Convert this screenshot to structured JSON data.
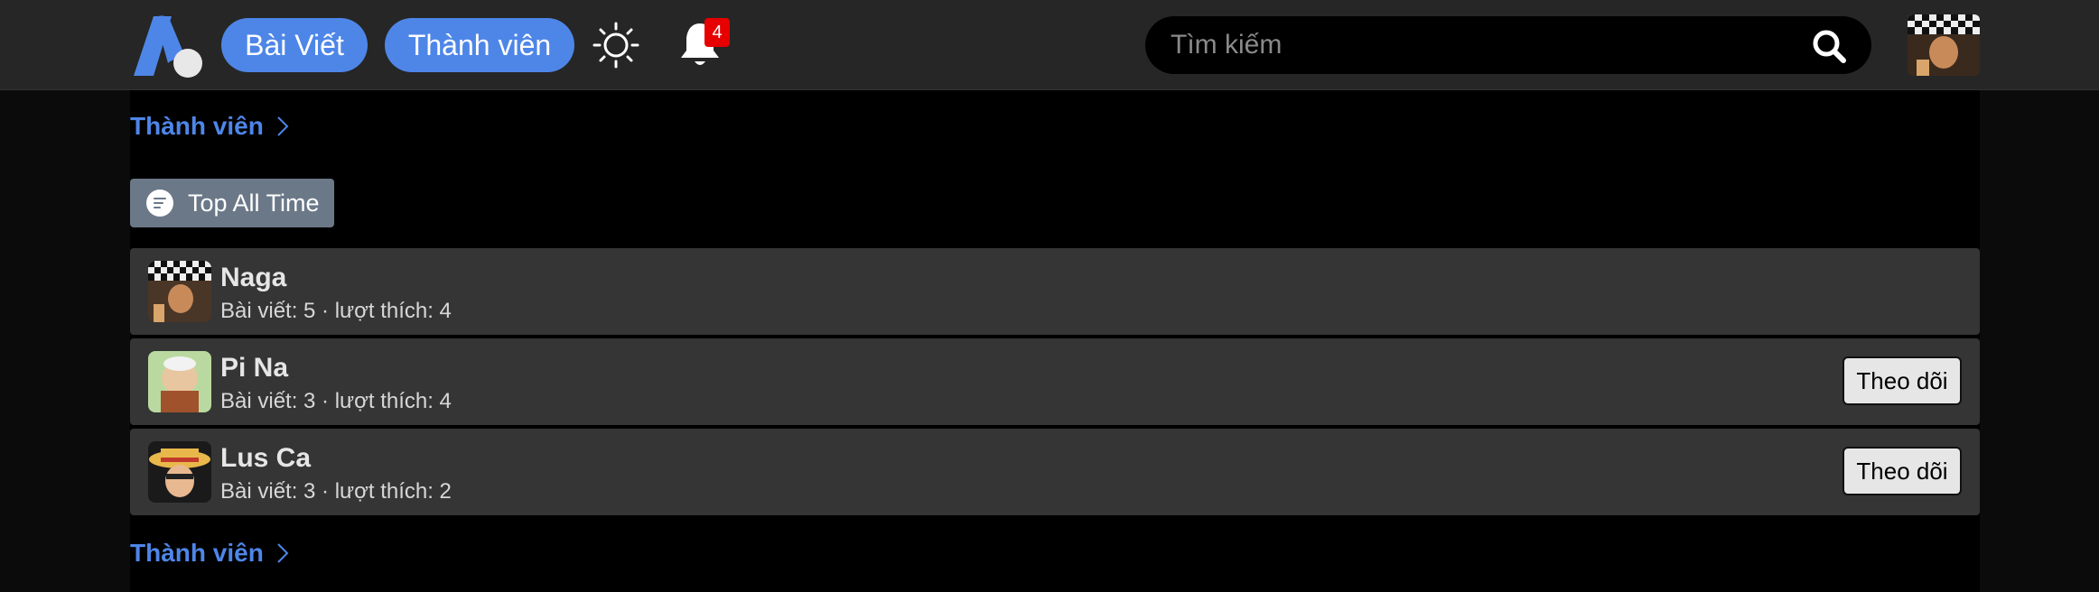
{
  "header": {
    "nav": [
      {
        "label": "Bài Viết"
      },
      {
        "label": "Thành viên"
      }
    ],
    "notification_count": "4",
    "search": {
      "placeholder": "Tìm kiếm"
    },
    "brand_color": "#4e86e8"
  },
  "breadcrumb": {
    "label": "Thành viên"
  },
  "filter": {
    "label": "Top All Time"
  },
  "members": [
    {
      "name": "Naga",
      "stats": "Bài viết: 5 · lượt thích: 4",
      "avatar": "checker-hat-avatar"
    },
    {
      "name": "Pi Na",
      "stats": "Bài viết: 3 · lượt thích: 4",
      "avatar": "green-bg-avatar",
      "follow_label": "Theo dõi"
    },
    {
      "name": "Lus Ca",
      "stats": "Bài viết: 3 · lượt thích: 2",
      "avatar": "straw-hat-avatar",
      "follow_label": "Theo dõi"
    }
  ],
  "breadcrumb_bottom": {
    "label": "Thành viên"
  }
}
